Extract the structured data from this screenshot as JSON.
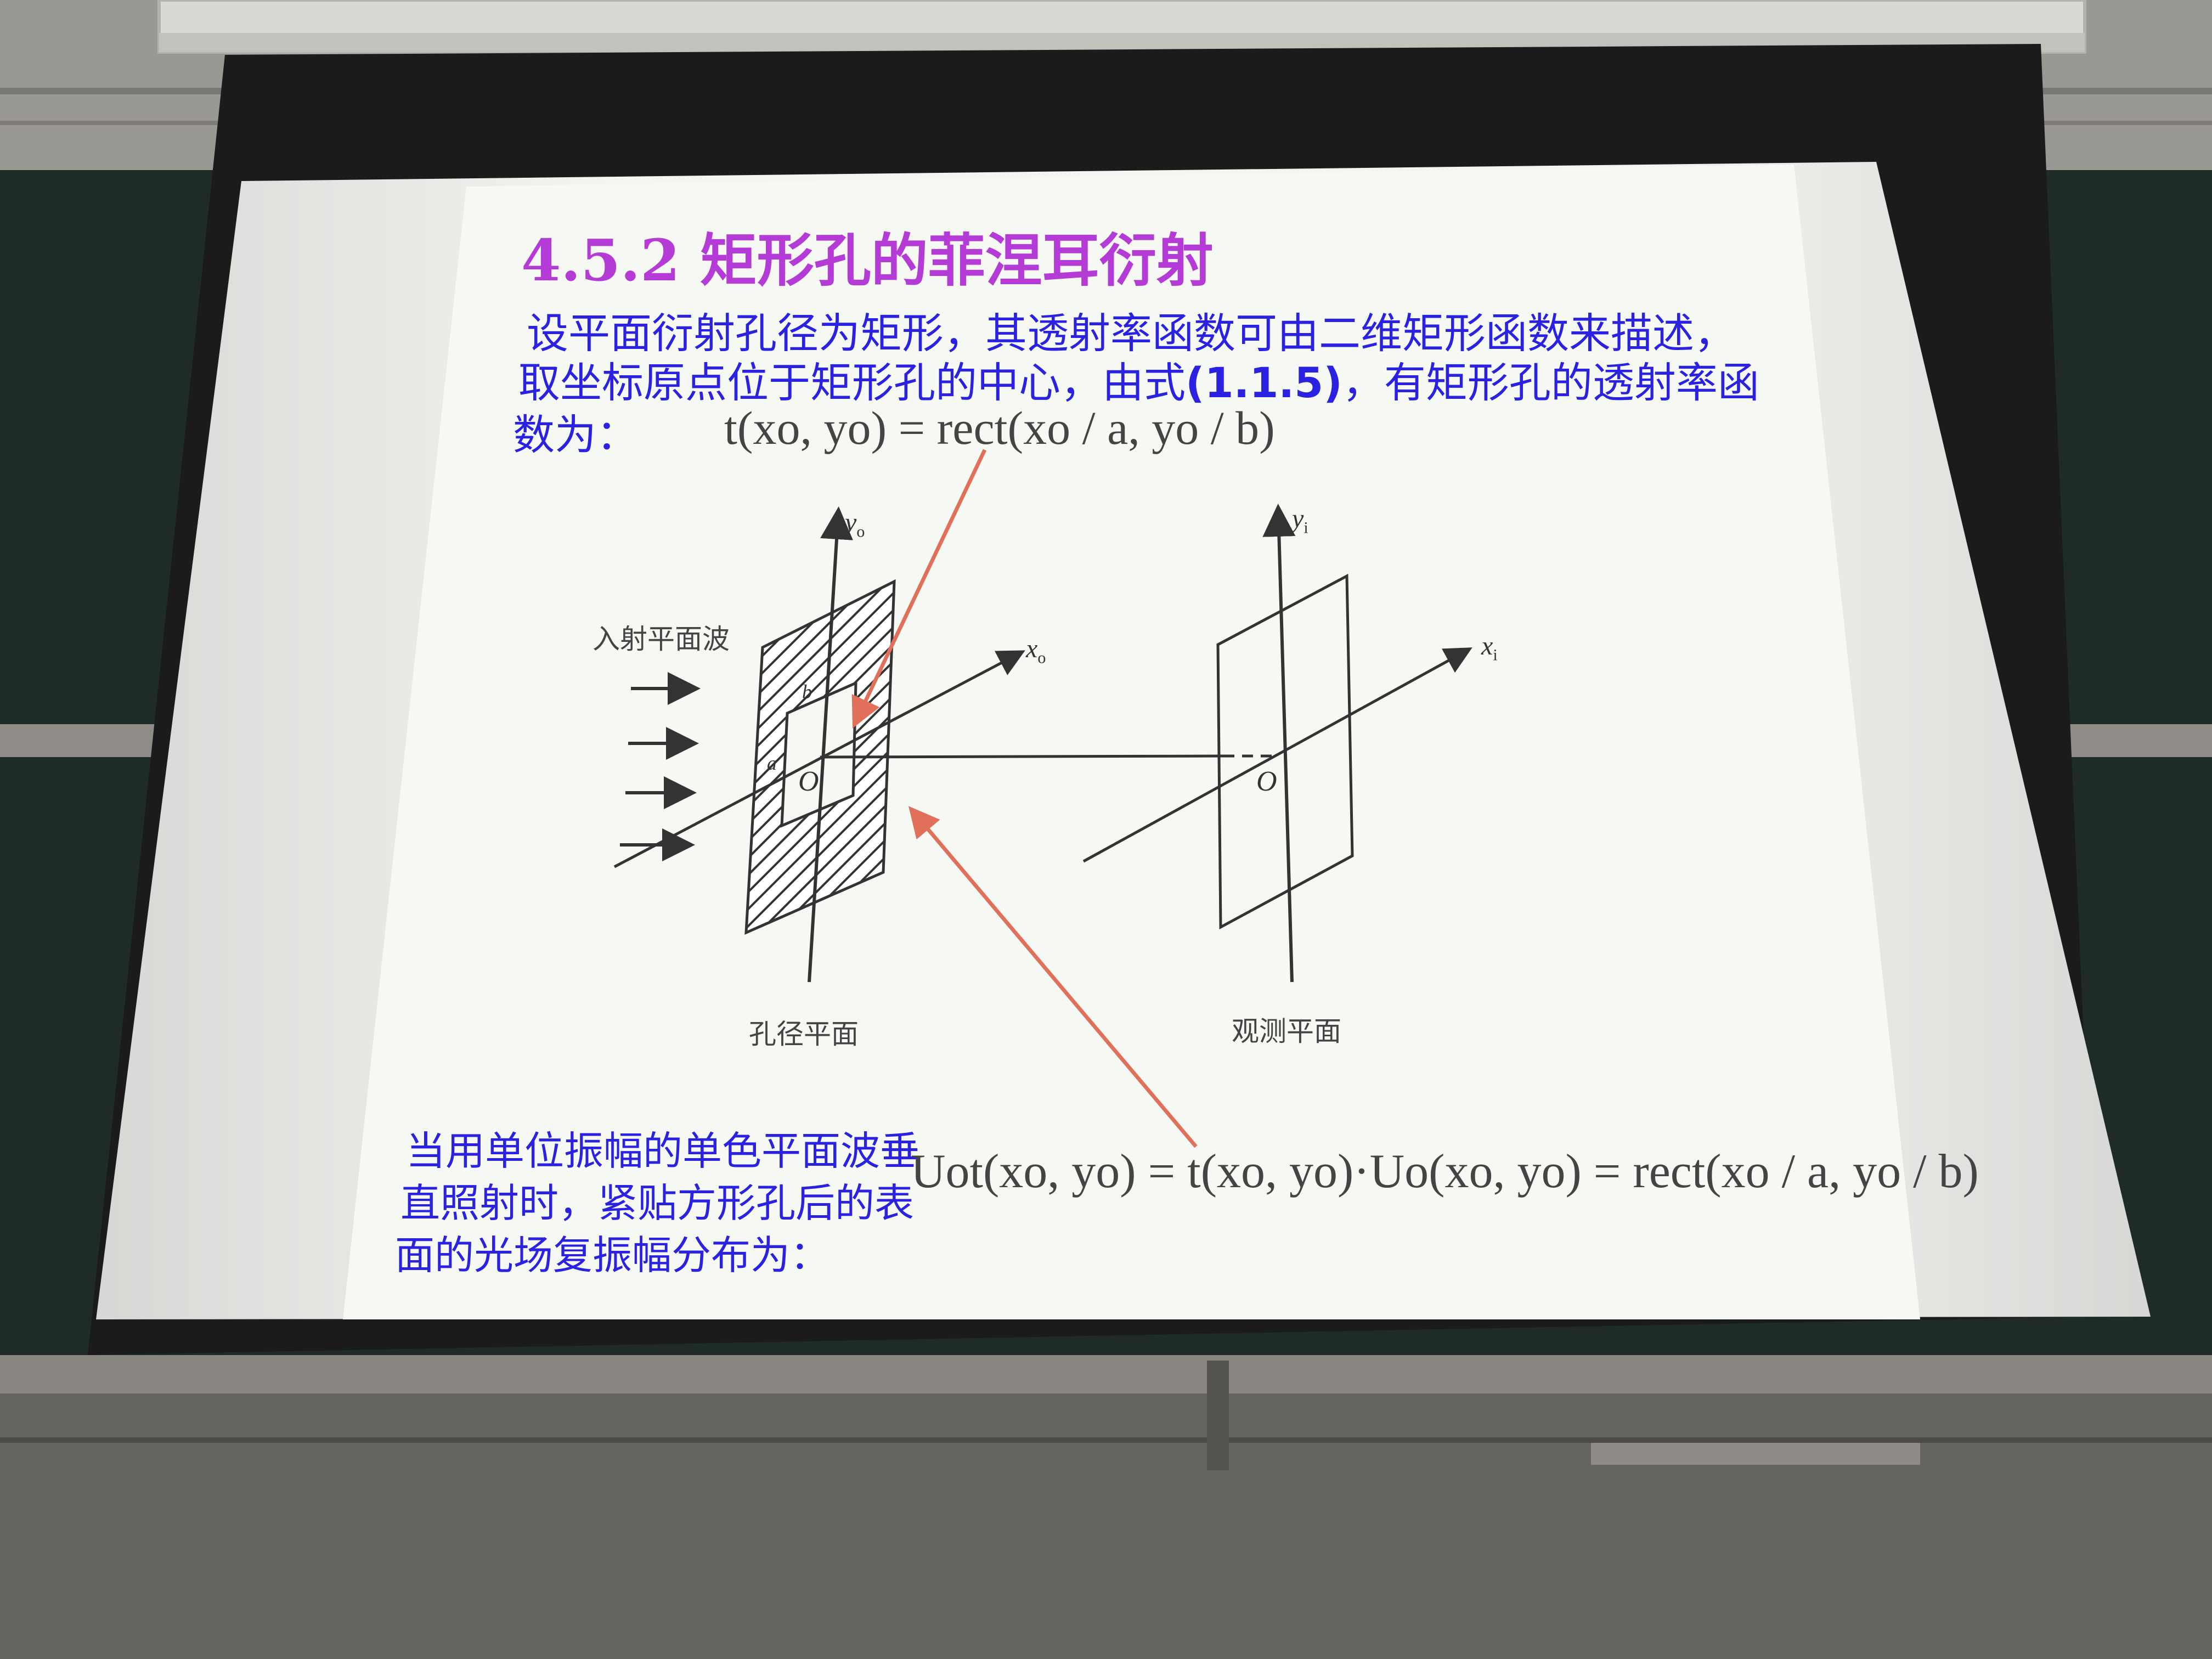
{
  "slide": {
    "title": "4.5.2 矩形孔的菲涅耳衍射",
    "intro": {
      "line1": "设平面衍射孔径为矩形，其透射率函数可由二维矩形函数来描述，",
      "line2_before": "取坐标原点位于矩形孔的中心，由式",
      "line2_ref": "(1.1.5)",
      "line2_after": "，有矩形孔的透射率函",
      "line3": "数为："
    },
    "formula1": "t(xo, yo) = rect(xo / a, yo / b)",
    "bottom_text": {
      "line1": "当用单位振幅的单色平面波垂",
      "line2": "直照射时，紧贴方形孔后的表",
      "line3": "面的光场复振幅分布为："
    },
    "formula2": "Uot(xo, yo) = t(xo, yo)·Uo(xo, yo) = rect(xo / a, yo / b)"
  },
  "diagram": {
    "incident_label": "入射平面波",
    "aperture_plane_label": "孔径平面",
    "observation_plane_label": "观测平面",
    "axis_yo": "y",
    "axis_yo_sub": "o",
    "axis_xo": "x",
    "axis_xo_sub": "o",
    "axis_yi": "y",
    "axis_yi_sub": "i",
    "axis_xi": "x",
    "axis_xi_sub": "i",
    "origin_label_left": "O",
    "origin_label_right": "O",
    "dim_a": "a",
    "dim_b": "b"
  },
  "colors": {
    "title": "#b43bd6",
    "body_text": "#2a22e0",
    "annotation_arrow": "#e0705a",
    "slide_bg": "#f4f6f2"
  }
}
